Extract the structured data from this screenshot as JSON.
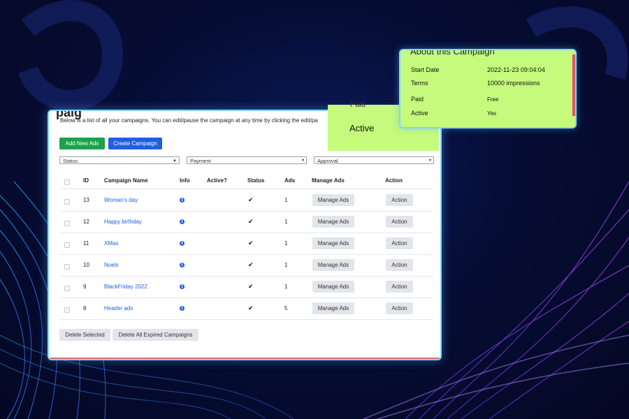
{
  "page": {
    "title_fragment": "paig",
    "description": "Below is a list of all your campaigns. You can edit/pause the campaign at any time by clicking the edit/pa"
  },
  "toolbar": {
    "add_new_ads": "Add New Ads",
    "create_campaign": "Create Campaign"
  },
  "filters": {
    "status": "Status",
    "payment": "Payment",
    "approval": "Approval"
  },
  "table": {
    "headers": {
      "id": "ID",
      "campaign_name": "Campaign Name",
      "info": "Info",
      "active": "Active?",
      "status": "Status",
      "ads": "Ads",
      "manage_ads": "Manage Ads",
      "action": "Action"
    },
    "rows": [
      {
        "id": "13",
        "name": "Woman's day",
        "ads": "1",
        "manage": "Manage Ads",
        "action": "Action"
      },
      {
        "id": "12",
        "name": "Happy birthday",
        "ads": "1",
        "manage": "Manage Ads",
        "action": "Action"
      },
      {
        "id": "11",
        "name": "XMas",
        "ads": "1",
        "manage": "Manage Ads",
        "action": "Action"
      },
      {
        "id": "10",
        "name": "Noels",
        "ads": "1",
        "manage": "Manage Ads",
        "action": "Action"
      },
      {
        "id": "9",
        "name": "BlackFriday 2022",
        "ads": "1",
        "manage": "Manage Ads",
        "action": "Action"
      },
      {
        "id": "8",
        "name": "Header ads",
        "ads": "5",
        "manage": "Manage Ads",
        "action": "Action"
      }
    ]
  },
  "footer": {
    "delete_selected": "Delete Selected",
    "delete_expired": "Delete All Expired Campaigns"
  },
  "about_popup": {
    "title": "About this Campaign",
    "start_date_label": "Start Date",
    "start_date_value": "2022-11-23  09:04:04",
    "terms_label": "Terms",
    "terms_value": "10000 impressions",
    "paid_label": "Paid",
    "paid_value": "Free",
    "active_label": "Active",
    "active_value": "Yes"
  },
  "status_card": {
    "fragment": "Paid",
    "value": "Active"
  },
  "icons": {
    "info": "info-circle-icon",
    "check": "check-icon",
    "dropdown": "chevron-down-icon"
  },
  "colors": {
    "accent_green": "#1aa34a",
    "accent_blue": "#1f5fe0",
    "popup_bg": "#c5fa7c",
    "link": "#1f5fe0"
  }
}
